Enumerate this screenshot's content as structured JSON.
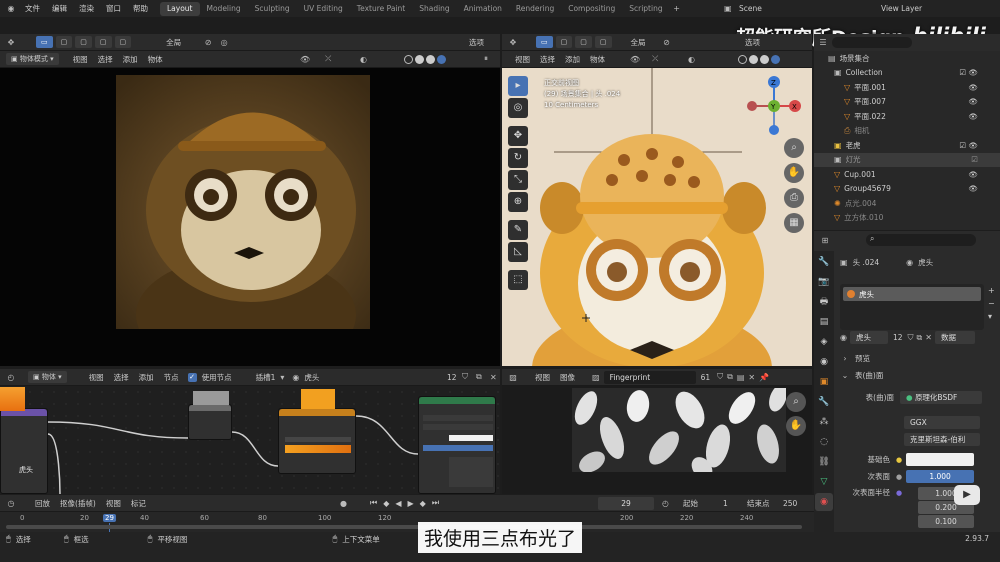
{
  "topbar": {
    "menus": [
      "文件",
      "编辑",
      "渲染",
      "窗口",
      "帮助"
    ],
    "workspaces": [
      "Layout",
      "Modeling",
      "Sculpting",
      "UV Editing",
      "Texture Paint",
      "Shading",
      "Animation",
      "Rendering",
      "Compositing",
      "Scripting"
    ],
    "active_workspace": "Layout",
    "scene_label": "Scene",
    "view_layer_label": "View Layer"
  },
  "watermark": {
    "text": "超能研究所Design",
    "logo": "bilibili"
  },
  "left_tool_header": {
    "global": "全局",
    "options": "选项"
  },
  "left_viewport": {
    "mode": "物体模式",
    "menus": [
      "视图",
      "选择",
      "添加",
      "物体"
    ]
  },
  "right_tool_header": {
    "global": "全局",
    "options": "选项"
  },
  "right_viewport": {
    "menus": [
      "视图",
      "选择",
      "添加",
      "物体"
    ],
    "overlay_title": "正交前视图",
    "overlay_collection": "(29) 场景集合 | 头 .024",
    "overlay_scale": "10 Centimeters",
    "gizmo": {
      "z": "Z",
      "y": "Y",
      "x": "X"
    }
  },
  "outliner": {
    "root": "场景集合",
    "rows": [
      {
        "label": "Collection",
        "indent": 0
      },
      {
        "label": "平面.001",
        "indent": 1
      },
      {
        "label": "平面.007",
        "indent": 1
      },
      {
        "label": "平面.022",
        "indent": 1
      },
      {
        "label": "相机",
        "indent": 1
      },
      {
        "label": "老虎",
        "indent": 0
      },
      {
        "label": "灯光",
        "indent": 0
      },
      {
        "label": "Cup.001",
        "indent": 0
      },
      {
        "label": "Group45679",
        "indent": 0
      },
      {
        "label": "点光.004",
        "indent": 0
      },
      {
        "label": "立方体.010",
        "indent": 0
      }
    ]
  },
  "properties": {
    "object_name": "头 .024",
    "material_name": "虎头",
    "slot_name": "虎头",
    "mat_field": "虎头",
    "users": "12",
    "data_label": "数据",
    "preview_label": "预览",
    "surface_section": "表(曲)面",
    "surface_label": "表(曲)面",
    "surface_value": "原理化BSDF",
    "distribution": "GGX",
    "subsurface_method": "克里斯坦森-伯利",
    "base_color_label": "基础色",
    "subsurface_label": "次表面",
    "subsurface_value": "1.000",
    "subsurface_radius_label": "次表面半径",
    "radius_values": [
      "1.000",
      "0.200",
      "0.100"
    ]
  },
  "node_editor": {
    "editor_label": "物体",
    "menus": [
      "视图",
      "选择",
      "添加",
      "节点"
    ],
    "use_nodes_label": "使用节点",
    "slot": "插槽1",
    "material": "虎头",
    "users": "12",
    "image_label": "虎头"
  },
  "image_editor": {
    "menus": [
      "视图",
      "图像"
    ],
    "image_name": "Fingerprint Texture.png",
    "users": "61"
  },
  "timeline": {
    "menus": [
      "回放",
      "抠像(插帧)",
      "视图",
      "标记"
    ],
    "current_frame": "29",
    "start_label": "起始",
    "start_value": "1",
    "end_label": "结束点",
    "end_value": "250",
    "ticks": [
      "0",
      "20",
      "29",
      "40",
      "60",
      "80",
      "100",
      "120",
      "200",
      "220",
      "240"
    ]
  },
  "status_bar": {
    "items": [
      "选择",
      "框选",
      "平移视图",
      "上下文菜单"
    ],
    "version": "2.93.7"
  },
  "subtitle": "我使用三点布光了",
  "colors": {
    "accent": "#4772b3",
    "orange": "#e08a2a",
    "timeline_current": "#4772b3"
  }
}
